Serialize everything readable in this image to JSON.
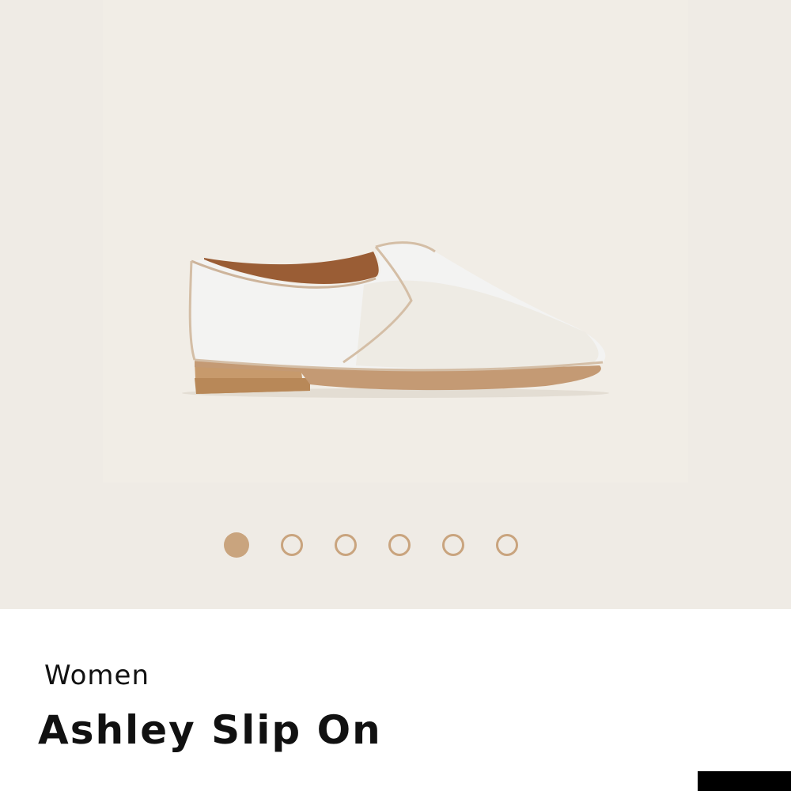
{
  "product": {
    "category": "Women",
    "name": "Ashley Slip On",
    "image_alt": "Ashley Slip On shoe, white leather with wooden heel"
  },
  "gallery": {
    "slide_count": 6,
    "active_index": 0
  },
  "colors": {
    "gallery_bg": "#efebe5",
    "accent": "#c9a47e",
    "text": "#111111",
    "cta": "#000000"
  }
}
